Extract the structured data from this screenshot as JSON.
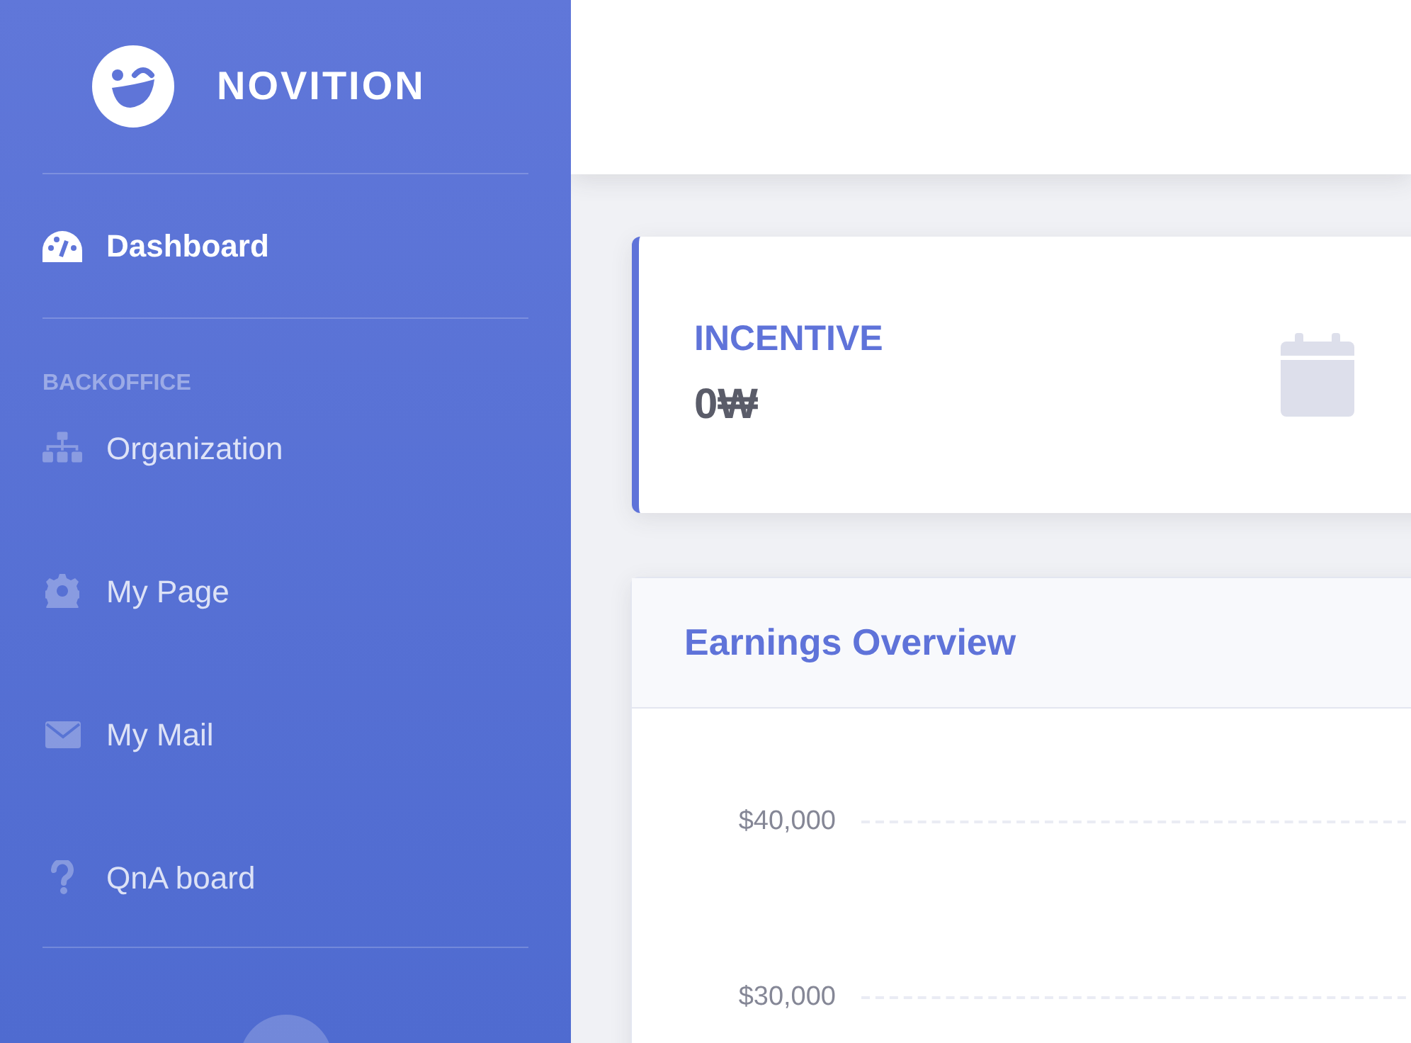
{
  "brand": {
    "name": "NOVITION"
  },
  "sidebar": {
    "items": [
      {
        "label": "Dashboard",
        "selected": true
      }
    ],
    "heading": "BACKOFFICE",
    "section_items": [
      {
        "label": "Organization",
        "selected": false
      },
      {
        "label": "My Page",
        "selected": false
      },
      {
        "label": "My Mail",
        "selected": false
      },
      {
        "label": "QnA board",
        "selected": false
      }
    ]
  },
  "incentive_card": {
    "title": "INCENTIVE",
    "value": "0₩"
  },
  "earnings_card": {
    "title": "Earnings Overview",
    "y_axis_labels": [
      "$40,000",
      "$30,000"
    ]
  }
}
